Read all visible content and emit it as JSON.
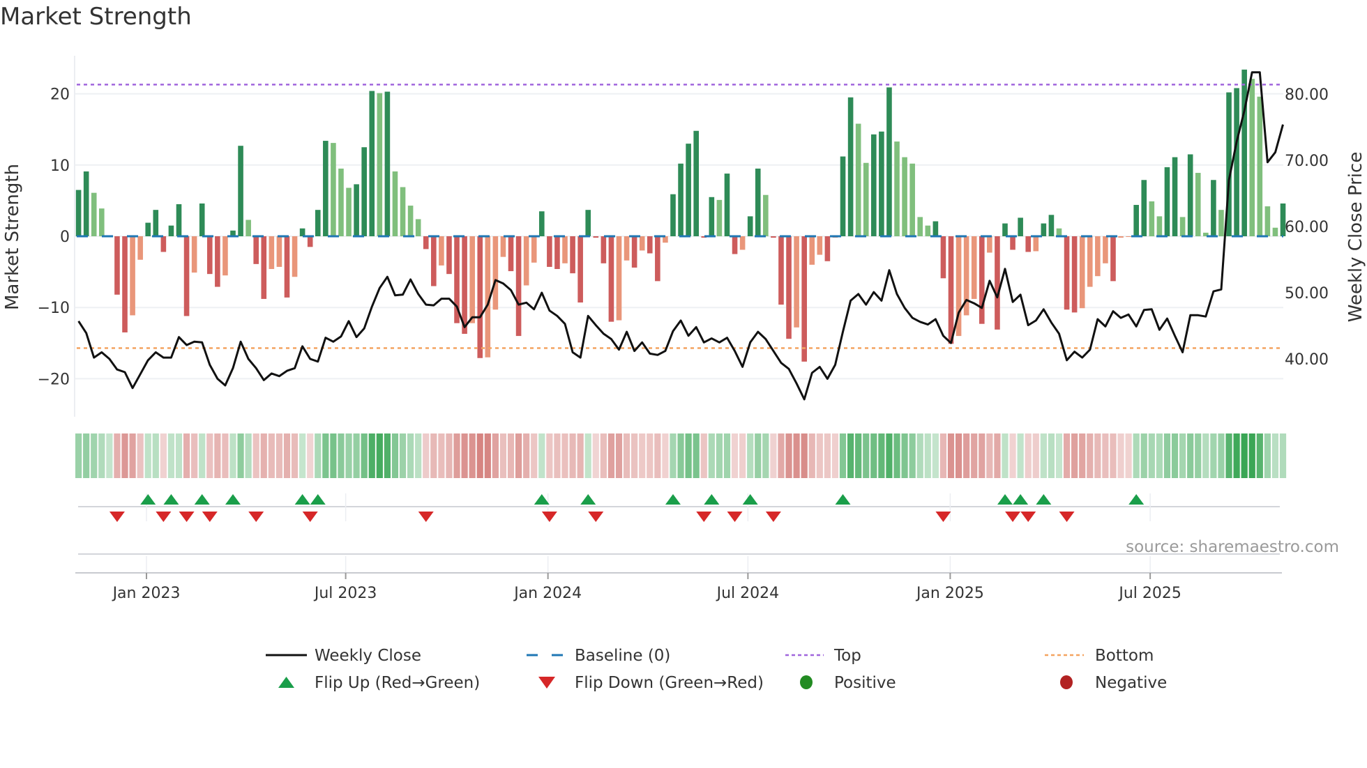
{
  "title": "Market Strength",
  "source": "source: sharemaestro.com",
  "colors": {
    "pos_strong": "#2e8b57",
    "pos_weak": "#80bf7d",
    "neg_strong": "#cd5c5c",
    "neg_weak": "#e9967a",
    "baseline": "#1f77b4",
    "top": "#a066dd",
    "bottom": "#f4a460",
    "close": "#111111",
    "flip_up": "#1a9e4a",
    "flip_down": "#d62728",
    "positive": "#228b22",
    "negative": "#b22222",
    "heat_pos": [
      58,
      166,
      85
    ],
    "heat_neg": [
      204,
      104,
      100
    ]
  },
  "legend": [
    {
      "label": "Weekly Close",
      "icon": "solid-line"
    },
    {
      "label": "Baseline (0)",
      "icon": "dashed-line"
    },
    {
      "label": "Top",
      "icon": "dotted-line"
    },
    {
      "label": "Bottom",
      "icon": "dotted-line"
    },
    {
      "label": "Flip Up (Red→Green)",
      "icon": "triangle-up"
    },
    {
      "label": "Flip Down (Green→Red)",
      "icon": "triangle-down"
    },
    {
      "label": "Positive",
      "icon": "circle"
    },
    {
      "label": "Negative",
      "icon": "circle"
    }
  ],
  "chart_data": {
    "type": "bar",
    "title": "Market Strength",
    "ylabel": "Market Strength",
    "ylabel_right": "Weekly Close Price",
    "ylim": [
      -25,
      26
    ],
    "ylim_right": [
      31.5,
      86
    ],
    "yticks": [
      {
        "value": 20,
        "label": "20"
      },
      {
        "value": 10,
        "label": "10"
      },
      {
        "value": 0,
        "label": "0"
      },
      {
        "value": -10,
        "label": "−10"
      },
      {
        "value": -20,
        "label": "−20"
      }
    ],
    "yticks_right": [
      {
        "value": 80,
        "label": "80.00"
      },
      {
        "value": 70,
        "label": "70.00"
      },
      {
        "value": 60,
        "label": "60.00"
      },
      {
        "value": 50,
        "label": "50.00"
      },
      {
        "value": 40,
        "label": "40.00"
      }
    ],
    "xticks": [
      {
        "week": 9.8,
        "label": "Jan 2023"
      },
      {
        "week": 35.6,
        "label": "Jul 2023"
      },
      {
        "week": 61.8,
        "label": "Jan 2024"
      },
      {
        "week": 87.7,
        "label": "Jul 2024"
      },
      {
        "week": 113.9,
        "label": "Jan 2025"
      },
      {
        "week": 139.8,
        "label": "Jul 2025"
      }
    ],
    "top_level": 21.3,
    "bottom_level": -15.7,
    "baseline": 0,
    "grid": true,
    "legend_position": "bottom",
    "series": [
      {
        "name": "Market Strength",
        "type": "bar",
        "values": [
          6.5,
          9.1,
          6.1,
          3.9,
          0.1,
          -8.2,
          -13.5,
          -11.1,
          -3.3,
          1.9,
          3.7,
          -2.2,
          1.5,
          4.5,
          -11.2,
          -5.1,
          4.6,
          -5.3,
          -7.1,
          -5.5,
          0.8,
          12.7,
          2.3,
          -3.9,
          -8.8,
          -4.6,
          -4.3,
          -8.6,
          -5.7,
          1.1,
          -1.5,
          3.7,
          13.4,
          13.1,
          9.5,
          6.8,
          7.3,
          12.5,
          20.4,
          20.1,
          20.3,
          9.1,
          6.9,
          4.3,
          2.4,
          -1.8,
          -7.0,
          -4.1,
          -5.3,
          -12.2,
          -13.7,
          -12.2,
          -17.1,
          -17.0,
          -10.3,
          -2.9,
          -4.9,
          -14.0,
          -6.9,
          -3.7,
          3.5,
          -4.3,
          -4.6,
          -3.8,
          -5.2,
          -9.3,
          3.7,
          -0.2,
          -3.8,
          -12.0,
          -11.8,
          -3.4,
          -4.4,
          -2.0,
          -2.4,
          -6.3,
          -0.9,
          5.9,
          10.2,
          13.0,
          14.8,
          -0.2,
          5.5,
          5.1,
          8.8,
          -2.5,
          -1.9,
          2.8,
          9.5,
          5.8,
          -0.2,
          -9.6,
          -14.4,
          -12.8,
          -17.6,
          -4.0,
          -2.6,
          -3.5,
          -0.2,
          11.2,
          19.5,
          15.8,
          10.3,
          14.3,
          14.7,
          20.9,
          13.3,
          11.1,
          10.2,
          2.7,
          1.5,
          2.1,
          -5.9,
          -15.1,
          -14.0,
          -11.1,
          -8.8,
          -12.3,
          -2.3,
          -13.1,
          1.8,
          -1.9,
          2.6,
          -2.2,
          -2.1,
          1.8,
          3.0,
          1.1,
          -10.3,
          -10.7,
          -10.1,
          -7.1,
          -5.6,
          -3.8,
          -6.3,
          -0.2,
          -0.1,
          4.4,
          7.9,
          4.9,
          2.8,
          9.7,
          11.1,
          2.7,
          11.5,
          8.9,
          0.5,
          7.9,
          3.7,
          20.2,
          20.8,
          23.4,
          22.1,
          19.6,
          4.2,
          1.2,
          4.6
        ]
      },
      {
        "name": "Weekly Close",
        "type": "line",
        "axis": "right",
        "values": [
          45.7,
          43.9,
          40.2,
          41.0,
          40.0,
          38.4,
          38.0,
          35.6,
          37.7,
          39.8,
          41.0,
          40.2,
          40.2,
          43.3,
          42.1,
          42.6,
          42.5,
          39.1,
          37.0,
          36.0,
          38.6,
          42.6,
          40.0,
          38.6,
          36.8,
          37.8,
          37.4,
          38.2,
          38.6,
          41.9,
          40.0,
          39.6,
          43.2,
          42.6,
          43.4,
          45.7,
          43.3,
          44.6,
          47.9,
          50.7,
          52.4,
          49.6,
          49.7,
          52.0,
          49.8,
          48.2,
          48.1,
          49.1,
          49.1,
          47.9,
          44.8,
          46.3,
          46.3,
          48.2,
          51.9,
          51.4,
          50.4,
          48.2,
          48.5,
          47.5,
          50.0,
          47.3,
          46.5,
          45.3,
          41.0,
          40.2,
          46.5,
          45.1,
          43.8,
          43.0,
          41.4,
          44.1,
          41.2,
          42.5,
          40.8,
          40.6,
          41.2,
          44.2,
          45.8,
          43.5,
          44.8,
          42.5,
          43.1,
          42.5,
          43.2,
          41.2,
          38.8,
          42.5,
          44.1,
          43.0,
          41.2,
          39.4,
          38.5,
          36.3,
          33.9,
          37.9,
          38.8,
          37.0,
          39.1,
          44.1,
          48.8,
          49.8,
          48.2,
          50.1,
          48.8,
          53.4,
          49.8,
          47.7,
          46.2,
          45.6,
          45.2,
          46.0,
          43.5,
          42.4,
          47.0,
          48.9,
          48.4,
          47.7,
          51.8,
          49.3,
          53.6,
          48.6,
          49.7,
          45.1,
          45.8,
          47.5,
          45.5,
          43.8,
          39.8,
          41.1,
          40.2,
          41.4,
          46.0,
          44.9,
          47.2,
          46.2,
          46.7,
          44.9,
          47.4,
          47.5,
          44.4,
          46.1,
          43.5,
          41.0,
          46.6,
          46.6,
          46.4,
          50.2,
          50.5,
          67.0,
          72.8,
          77.5,
          83.3,
          83.3,
          69.7,
          71.2,
          75.4
        ]
      }
    ],
    "flip_up_weeks": [
      10,
      13,
      17,
      21,
      30,
      32,
      61,
      67,
      78,
      83,
      88,
      100,
      121,
      123,
      126,
      138
    ],
    "flip_down_weeks": [
      6,
      12,
      15,
      18,
      24,
      31,
      46,
      62,
      68,
      82,
      86,
      91,
      113,
      122,
      124,
      129
    ]
  }
}
